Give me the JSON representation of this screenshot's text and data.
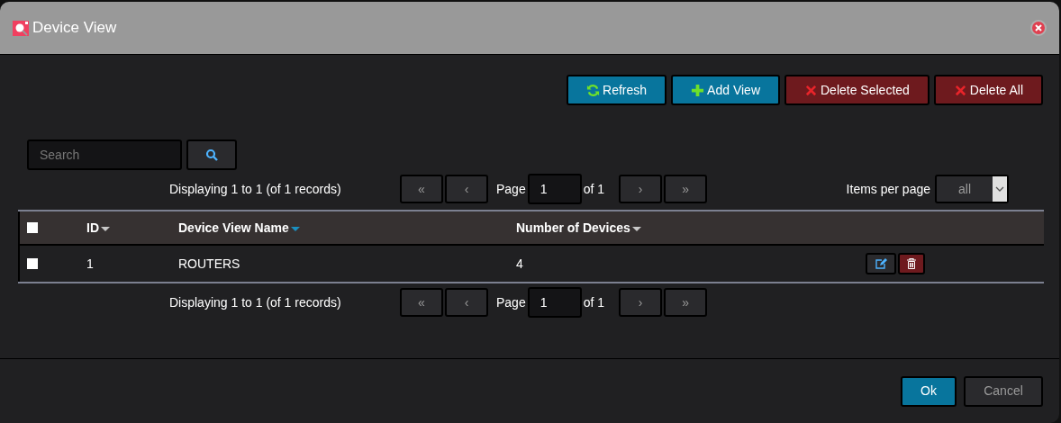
{
  "window": {
    "title": "Device View"
  },
  "toolbar": [
    {
      "label": "Refresh",
      "kind": "refresh"
    },
    {
      "label": "Add View",
      "kind": "add"
    },
    {
      "label": "Delete Selected",
      "kind": "delete"
    },
    {
      "label": "Delete All",
      "kind": "delete"
    }
  ],
  "search": {
    "placeholder": "Search"
  },
  "pager_top": {
    "summary": "Displaying 1 to 1 (of 1 records)",
    "first": "«",
    "prev": "‹",
    "page_label": "Page",
    "page": "1",
    "of": "of 1",
    "next": "›",
    "last": "»",
    "items_label": "Items per page",
    "items_value": "all"
  },
  "table": {
    "select_all": {
      "checked": false
    },
    "columns": [
      {
        "label": "ID",
        "sorted": false
      },
      {
        "label": "Device View Name",
        "sorted": true
      },
      {
        "label": "Number of Devices",
        "sorted": false
      }
    ],
    "rows": [
      {
        "checked": false,
        "id": "1",
        "name": "ROUTERS",
        "devices": "4"
      }
    ]
  },
  "pager_bottom": {
    "summary": "Displaying 1 to 1 (of 1 records)",
    "first": "«",
    "prev": "‹",
    "page_label": "Page",
    "page": "1",
    "of": "of 1",
    "next": "›",
    "last": "»"
  },
  "footer": [
    {
      "label": "Ok",
      "kind": "primary"
    },
    {
      "label": "Cancel",
      "kind": "secondary"
    }
  ]
}
